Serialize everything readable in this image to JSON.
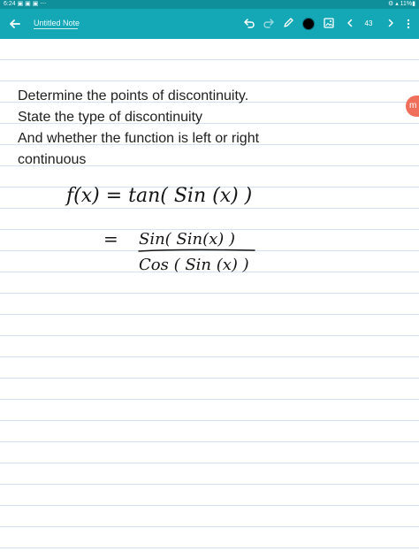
{
  "status_bar": {
    "time": "6:24",
    "left_icons": "▣ ▣ ▣ ⋯",
    "right_status": "⚙ ▴ 11%▮"
  },
  "app_bar": {
    "title": "Untitled Note",
    "page_number": "43"
  },
  "note": {
    "typed_lines": [
      "Determine the points of discontinuity.",
      "State the type of discontinuity",
      "And whether the function is left or right",
      "continuous"
    ],
    "handwriting": {
      "line1": "f(x) = tan( Sin (x) )",
      "equals": "=",
      "numerator": "Sin( Sin(x) )",
      "denominator": "Cos ( Sin (x) )"
    }
  },
  "side_tab": {
    "mark": "m"
  },
  "icons": {
    "back": "arrow-left-icon",
    "undo": "undo-icon",
    "redo": "redo-icon",
    "pen": "pen-icon",
    "image": "image-icon",
    "previous": "chevron-left-icon",
    "next": "chevron-right-icon",
    "more": "more-vertical-icon"
  },
  "colors": {
    "status_bar": "#0f8f9a",
    "app_bar": "#14a7b5",
    "ruled_lines": "#d3e3f2",
    "side_tab": "#f06f5b"
  }
}
